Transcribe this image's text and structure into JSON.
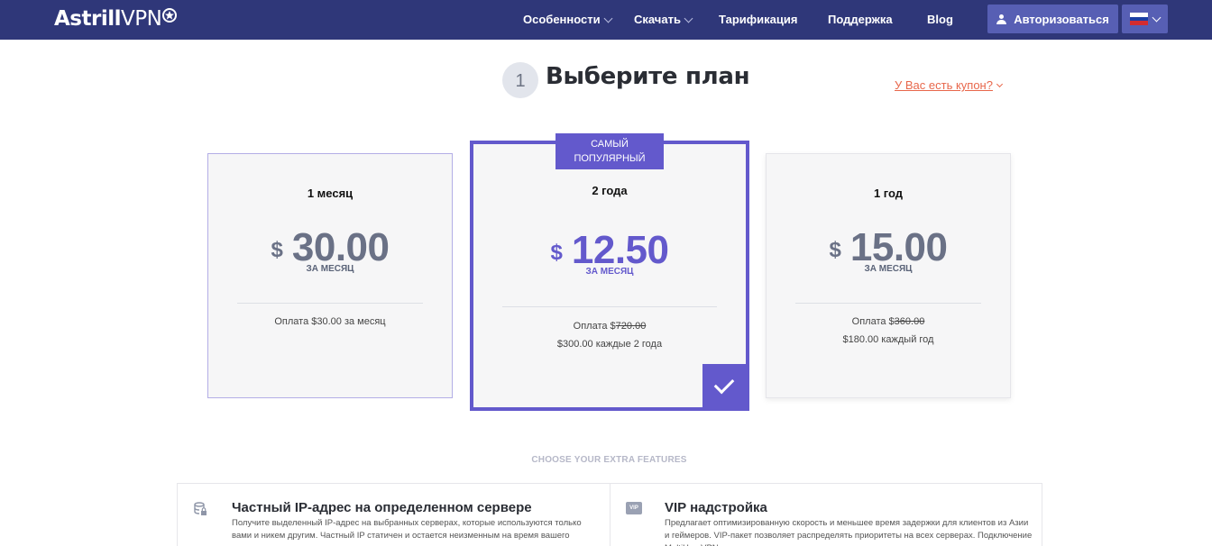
{
  "header": {
    "logo_bold": "Astrill",
    "logo_light": "VPN",
    "nav": [
      {
        "label": "Особенности"
      },
      {
        "label": "Скачать"
      },
      {
        "label": "Тарификация"
      },
      {
        "label": "Поддержка"
      },
      {
        "label": "Blog"
      }
    ],
    "login_label": "Авторизоваться",
    "language_flag": {
      "stripes": [
        "#ffffff",
        "#1c3fa3",
        "#d42c2f"
      ]
    }
  },
  "step": {
    "number": "1",
    "title": "Выберите план",
    "coupon_link": "У Вас есть купон?"
  },
  "plans": [
    {
      "period": "1 месяц",
      "currency": "$",
      "price": "30.00",
      "per": "ЗА МЕСЯЦ",
      "pay_prefix": "Оплата $30.00 за месяц",
      "pay_old": "",
      "pay_line2": "",
      "selected": false
    },
    {
      "badge": "САМЫЙ ПОПУЛЯРНЫЙ",
      "period": "2 года",
      "currency": "$",
      "price": "12.50",
      "per": "ЗА МЕСЯЦ",
      "pay_prefix": "Оплата $",
      "pay_old": "720.00",
      "pay_line2": "$300.00 каждые 2 года",
      "selected": true
    },
    {
      "period": "1 год",
      "currency": "$",
      "price": "15.00",
      "per": "ЗА МЕСЯЦ",
      "pay_prefix": "Оплата $",
      "pay_old": "360.00",
      "pay_line2": "$180.00 каждый год",
      "selected": false
    }
  ],
  "extras": {
    "title": "CHOOSE YOUR EXTRA FEATURES",
    "items": [
      {
        "icon": "database-lock-icon",
        "title": "Частный IP-адрес на определенном сервере",
        "desc": "Получите выделенный IP-адрес на выбранных серверах, которые используются только вами и никем другим. Частный IP статичен и остается неизменным на время вашего"
      },
      {
        "icon": "vip-icon",
        "icon_text": "VIP",
        "title": "VIP надстройка",
        "desc": "Предлагает оптимизированную скорость и меньшее время задержки для клиентов из Азии и геймеров. VIP-пакет позволяет распределять приоритеты на всех серверах. Подключение MultiHop VPN"
      }
    ]
  },
  "colors": {
    "header_bg": "#2f3779",
    "accent": "#6359cc",
    "coupon": "#e8674b"
  }
}
